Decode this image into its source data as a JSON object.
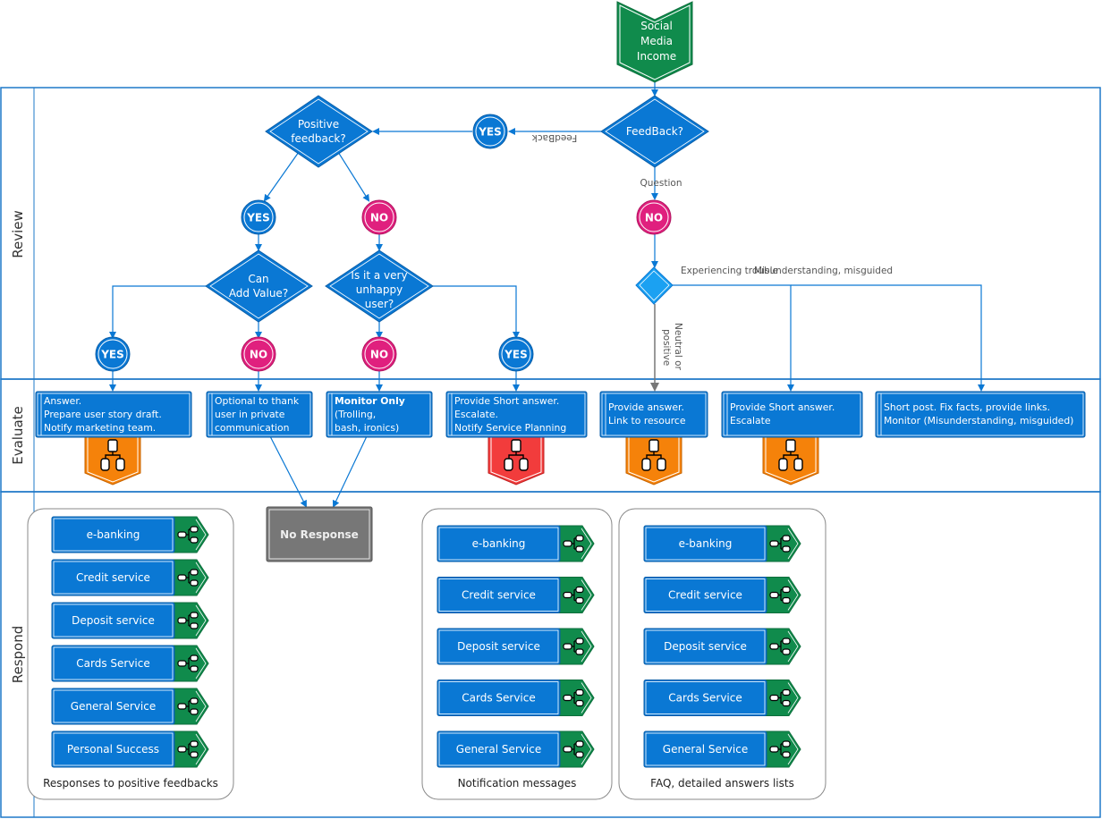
{
  "colors": {
    "blue": "#0a78d4",
    "blue_light": "#1ba1f2",
    "pink": "#e0207e",
    "green": "#108b4c",
    "orange": "#f5820a",
    "red": "#f23c3c",
    "gray": "#777777",
    "lane_border": "#1e78c8"
  },
  "start": {
    "lines": [
      "Social",
      "Media",
      "Income"
    ]
  },
  "lanes": [
    {
      "label": "Review"
    },
    {
      "label": "Evaluate"
    },
    {
      "label": "Respond"
    }
  ],
  "decisions": {
    "feedback": {
      "lines": [
        "FeedBack?"
      ]
    },
    "positive": {
      "lines": [
        "Positive",
        "feedback?"
      ]
    },
    "add_value": {
      "lines": [
        "Can",
        "Add Value?"
      ]
    },
    "unhappy": {
      "lines": [
        "Is it  a very",
        "unhappy",
        "user?"
      ]
    }
  },
  "circles": {
    "yes_feedback": "YES",
    "yes_positive": "YES",
    "no_positive": "NO",
    "no_question": "NO",
    "yes_add_value": "YES",
    "no_add_value": "NO",
    "no_unhappy": "NO",
    "yes_unhappy": "YES"
  },
  "edge_labels": {
    "feedback": "FeedBack",
    "question": "Question",
    "experiencing_trouble": "Experiencing trouble",
    "misunderstanding": "Misunderstanding, misguided",
    "neutral_1": "Neutral or",
    "neutral_2": "positive"
  },
  "evaluate_boxes": [
    {
      "lines": [
        "Answer.",
        "Prepare user story draft.",
        "Notify marketing team."
      ],
      "badge": "orange"
    },
    {
      "lines": [
        "Optional to thank",
        "user in private",
        "communication"
      ],
      "badge": null
    },
    {
      "bold": "Monitor Only",
      "lines": [
        "",
        "(Trolling,",
        "bash, ironics)"
      ],
      "badge": null
    },
    {
      "lines": [
        "Provide Short answer.",
        "Escalate.",
        "Notify Service Planning"
      ],
      "badge": "red"
    },
    {
      "lines": [
        "Provide answer.",
        "Link to resource"
      ],
      "badge": "orange"
    },
    {
      "lines": [
        "Provide Short answer.",
        "Escalate"
      ],
      "badge": "orange"
    },
    {
      "lines": [
        "Short post. Fix facts, provide links.",
        "Monitor (Misunderstanding, misguided)"
      ],
      "badge": null
    }
  ],
  "no_response": "No Response",
  "groups": [
    {
      "caption": "Responses to positive feedbacks",
      "items": [
        "e-banking",
        "Credit service",
        "Deposit service",
        "Cards Service",
        "General Service",
        "Personal Success"
      ]
    },
    {
      "caption": "Notification messages",
      "items": [
        "e-banking",
        "Credit service",
        "Deposit service",
        "Cards Service",
        "General Service"
      ]
    },
    {
      "caption": "FAQ, detailed answers lists",
      "items": [
        "e-banking",
        "Credit service",
        "Deposit service",
        "Cards Service",
        "General Service"
      ]
    }
  ]
}
